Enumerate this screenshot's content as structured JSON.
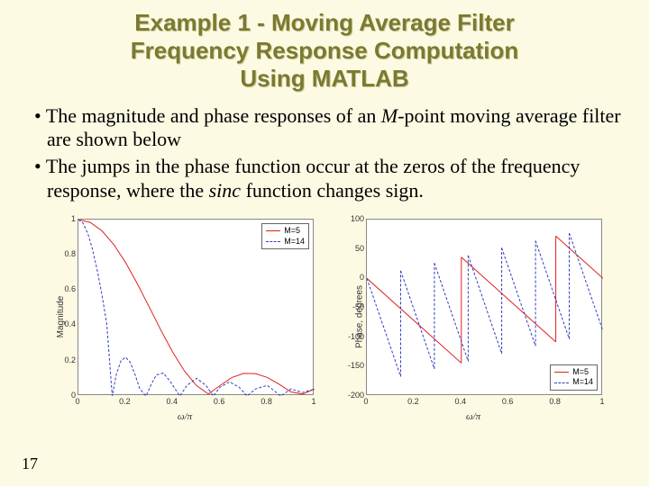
{
  "title_l1": "Example 1 - Moving Average Filter",
  "title_l2": "Frequency Response Computation",
  "title_l3": "Using MATLAB",
  "bullet1_a": "The magnitude and phase responses of an ",
  "bullet1_m": "M",
  "bullet1_b": "-point moving average filter are shown below",
  "bullet2_a": "The jumps in the phase function occur at the zeros of the frequency response, where the ",
  "bullet2_sinc": "sinc",
  "bullet2_b": " function changes sign.",
  "page_number": "17",
  "chart_data": [
    {
      "type": "line",
      "ylabel": "Magnitude",
      "xlabel": "ω/π",
      "xlim": [
        0,
        1
      ],
      "ylim": [
        0,
        1
      ],
      "xticks": [
        "0",
        "0.2",
        "0.4",
        "0.6",
        "0.8",
        "1"
      ],
      "yticks": [
        "0",
        "0.2",
        "0.4",
        "0.6",
        "0.8",
        "1"
      ],
      "legend": {
        "pos": "top-right",
        "entries": [
          "M=5",
          "M=14"
        ]
      },
      "series": [
        {
          "name": "M=5",
          "color": "#e02020",
          "dash": "solid",
          "x": [
            0,
            0.05,
            0.1,
            0.15,
            0.2,
            0.25,
            0.3,
            0.35,
            0.4,
            0.45,
            0.5,
            0.55,
            0.6,
            0.65,
            0.7,
            0.75,
            0.8,
            0.85,
            0.9,
            0.95,
            1
          ],
          "values": [
            1,
            0.984,
            0.936,
            0.858,
            0.756,
            0.635,
            0.504,
            0.371,
            0.247,
            0.14,
            0.059,
            0.011,
            0.059,
            0.105,
            0.128,
            0.127,
            0.105,
            0.067,
            0.023,
            0.011,
            0.04
          ]
        },
        {
          "name": "M=14",
          "color": "#3040c0",
          "dash": "dashed",
          "x": [
            0,
            0.02,
            0.04,
            0.06,
            0.08,
            0.1,
            0.12,
            0.143,
            0.16,
            0.18,
            0.2,
            0.22,
            0.24,
            0.26,
            0.286,
            0.31,
            0.33,
            0.36,
            0.39,
            0.429,
            0.46,
            0.5,
            0.54,
            0.571,
            0.6,
            0.64,
            0.68,
            0.714,
            0.75,
            0.8,
            0.857,
            0.9,
            0.95,
            1
          ],
          "values": [
            1,
            0.98,
            0.92,
            0.83,
            0.71,
            0.57,
            0.41,
            0,
            0.12,
            0.2,
            0.22,
            0.19,
            0.12,
            0.04,
            0,
            0.07,
            0.12,
            0.13,
            0.08,
            0,
            0.06,
            0.1,
            0.06,
            0,
            0.05,
            0.08,
            0.05,
            0,
            0.04,
            0.06,
            0,
            0.04,
            0.02,
            0.04
          ]
        }
      ]
    },
    {
      "type": "line",
      "ylabel": "Phase, degrees",
      "xlabel": "ω/π",
      "xlim": [
        0,
        1
      ],
      "ylim": [
        -200,
        100
      ],
      "xticks": [
        "0",
        "0.2",
        "0.4",
        "0.6",
        "0.8",
        "1"
      ],
      "yticks": [
        "-200",
        "-150",
        "-100",
        "-50",
        "0",
        "50",
        "100"
      ],
      "legend": {
        "pos": "bottom-right",
        "entries": [
          "M=5",
          "M=14"
        ]
      },
      "series": [
        {
          "name": "M=5",
          "color": "#e02020",
          "dash": "solid",
          "segments": [
            {
              "x": [
                0,
                0.4
              ],
              "y": [
                0,
                -144
              ]
            },
            {
              "x": [
                0.4,
                0.4
              ],
              "y": [
                -144,
                36
              ]
            },
            {
              "x": [
                0.4,
                0.8
              ],
              "y": [
                36,
                -108
              ]
            },
            {
              "x": [
                0.8,
                0.8
              ],
              "y": [
                -108,
                72
              ]
            },
            {
              "x": [
                0.8,
                1
              ],
              "y": [
                72,
                0
              ]
            }
          ]
        },
        {
          "name": "M=14",
          "color": "#3040c0",
          "dash": "dashed",
          "segments": [
            {
              "x": [
                0,
                0.143
              ],
              "y": [
                0,
                -167
              ]
            },
            {
              "x": [
                0.143,
                0.143
              ],
              "y": [
                -167,
                13
              ]
            },
            {
              "x": [
                0.143,
                0.286
              ],
              "y": [
                13,
                -154
              ]
            },
            {
              "x": [
                0.286,
                0.286
              ],
              "y": [
                -154,
                26
              ]
            },
            {
              "x": [
                0.286,
                0.429
              ],
              "y": [
                26,
                -141
              ]
            },
            {
              "x": [
                0.429,
                0.429
              ],
              "y": [
                -141,
                39
              ]
            },
            {
              "x": [
                0.429,
                0.571
              ],
              "y": [
                39,
                -128
              ]
            },
            {
              "x": [
                0.571,
                0.571
              ],
              "y": [
                -128,
                52
              ]
            },
            {
              "x": [
                0.571,
                0.714
              ],
              "y": [
                52,
                -115
              ]
            },
            {
              "x": [
                0.714,
                0.714
              ],
              "y": [
                -115,
                64
              ]
            },
            {
              "x": [
                0.714,
                0.857
              ],
              "y": [
                64,
                -103
              ]
            },
            {
              "x": [
                0.857,
                0.857
              ],
              "y": [
                -103,
                77
              ]
            },
            {
              "x": [
                0.857,
                1
              ],
              "y": [
                77,
                -90
              ]
            }
          ]
        }
      ]
    }
  ]
}
